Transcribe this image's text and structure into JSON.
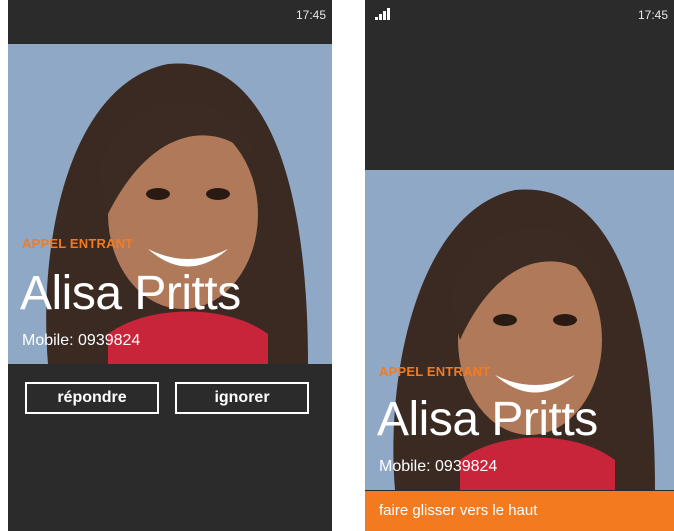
{
  "colors": {
    "accent": "#f47a20",
    "background": "#2b2b2b",
    "text": "#ffffff"
  },
  "left_screen": {
    "status": {
      "time": "17:45"
    },
    "call_label": "APPEL ENTRANT",
    "caller_name": "Alisa Pritts",
    "caller_number": "Mobile: 0939824",
    "answer_label": "répondre",
    "ignore_label": "ignorer"
  },
  "right_screen": {
    "status": {
      "time": "17:45",
      "signal_icon": "signal-strength-icon"
    },
    "call_label": "APPEL ENTRANT",
    "caller_name": "Alisa Pritts",
    "caller_number": "Mobile: 0939824",
    "swipe_label": "faire glisser vers le haut"
  }
}
